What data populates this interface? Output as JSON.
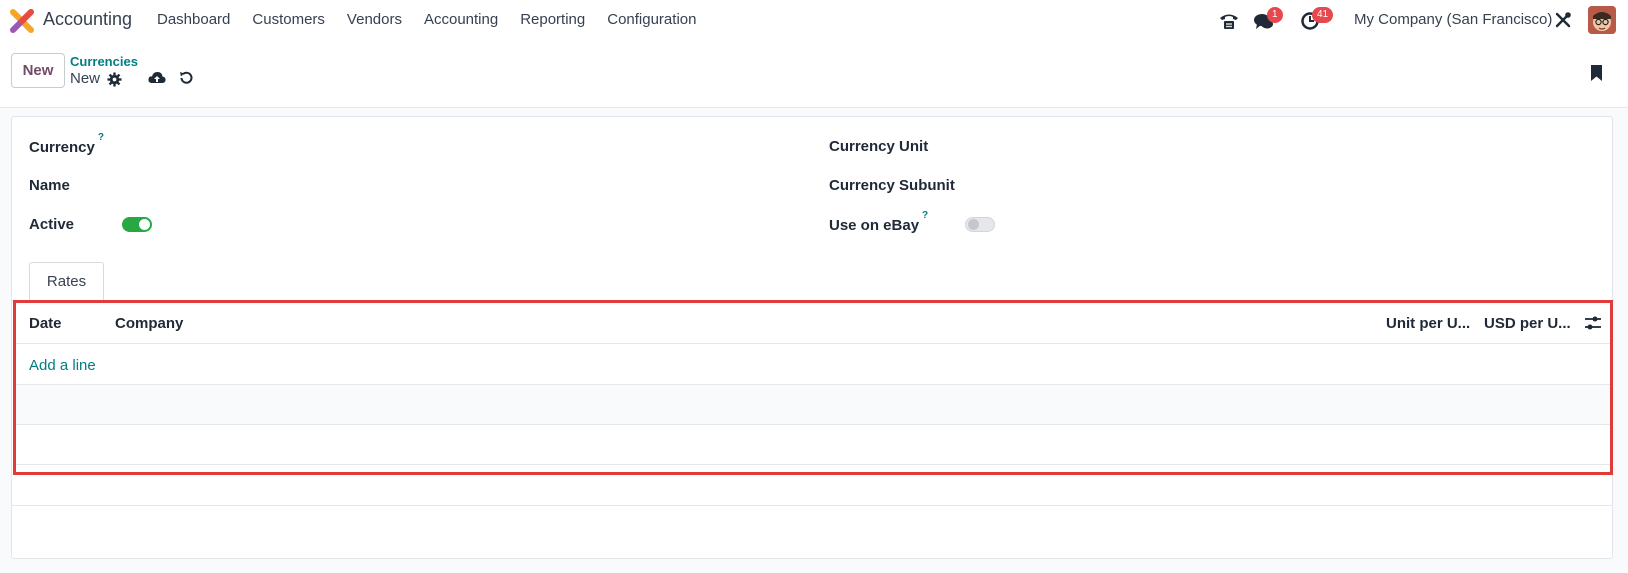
{
  "navbar": {
    "app_name": "Accounting",
    "menu": [
      "Dashboard",
      "Customers",
      "Vendors",
      "Accounting",
      "Reporting",
      "Configuration"
    ],
    "messages_badge": "1",
    "activities_badge": "41",
    "company": "My Company (San Francisco)"
  },
  "control": {
    "new_label": "New",
    "breadcrumb": "Currencies",
    "record_name": "New"
  },
  "form": {
    "currency_label": "Currency",
    "help_mark": "?",
    "name_label": "Name",
    "active_label": "Active",
    "currency_unit_label": "Currency Unit",
    "currency_subunit_label": "Currency Subunit",
    "use_on_ebay_label": "Use on eBay",
    "active_on": true,
    "ebay_on": false
  },
  "tabs": {
    "rates": "Rates"
  },
  "rates_table": {
    "columns": [
      "Date",
      "Company",
      "Unit per U...",
      "USD per U..."
    ],
    "add_line": "Add a line"
  },
  "colors": {
    "accent": "#017e84",
    "brand": "#714b67",
    "toggle_on": "#28a745",
    "highlight": "#e03b38"
  }
}
